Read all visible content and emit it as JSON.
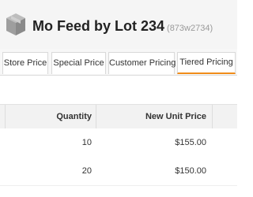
{
  "header": {
    "title": "Mo Feed by Lot 234",
    "sku": "(873w2734)",
    "logo_icon": "box-icon"
  },
  "tabs": [
    {
      "label": "Store Price",
      "active": false
    },
    {
      "label": "Special Price",
      "active": false
    },
    {
      "label": "Customer Pricing",
      "active": false
    },
    {
      "label": "Tiered Pricing",
      "active": true
    }
  ],
  "colors": {
    "accent": "#f08c1a"
  },
  "table": {
    "columns": [
      "Quantity",
      "New Unit Price"
    ],
    "rows": [
      {
        "quantity": "10",
        "price": "$155.00"
      },
      {
        "quantity": "20",
        "price": "$150.00"
      }
    ]
  }
}
